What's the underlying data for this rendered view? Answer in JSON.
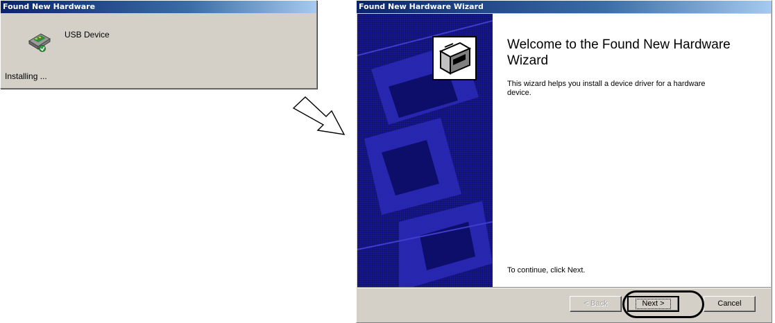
{
  "popup": {
    "title": "Found New Hardware",
    "device_name": "USB Device",
    "status": "Installing ...",
    "icon": "usb-device-icon"
  },
  "arrow": {
    "icon": "hollow-arrow-down-right-icon"
  },
  "wizard": {
    "title": "Found New Hardware Wizard",
    "heading": "Welcome to the Found New Hardware Wizard",
    "intro": "This wizard helps you install a device driver for a hardware device.",
    "continue_text": "To continue, click Next.",
    "icon": "hardware-box-icon",
    "banner_color": "#17178f",
    "buttons": {
      "back": "< Back",
      "next": "Next >",
      "cancel": "Cancel"
    }
  },
  "colors": {
    "titlebar_start": "#0a246a",
    "titlebar_end": "#a6caf0",
    "dialog_face": "#d4d0c8"
  }
}
